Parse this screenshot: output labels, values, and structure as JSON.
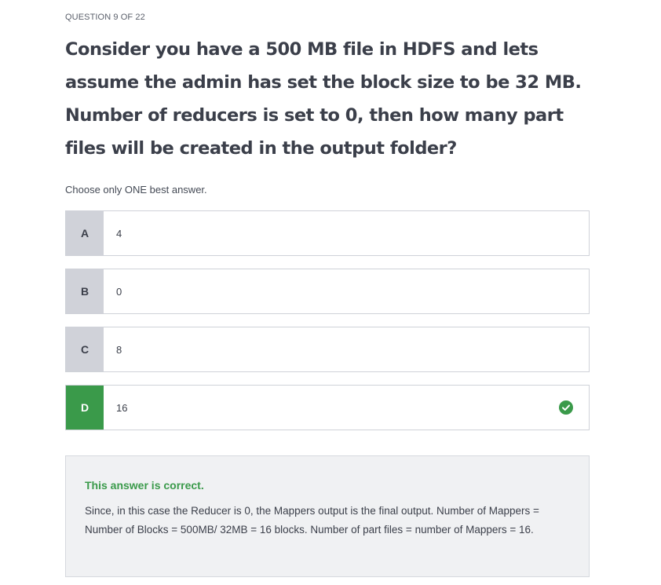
{
  "header": {
    "counter": "QUESTION 9 OF 22"
  },
  "question": {
    "text": "Consider you have a 500 MB file in HDFS and lets assume the admin has set the block size to be 32 MB. Number of reducers is set to 0, then how many part files will be created in the output folder?",
    "instruction": "Choose only ONE best answer."
  },
  "options": [
    {
      "letter": "A",
      "text": "4"
    },
    {
      "letter": "B",
      "text": "0"
    },
    {
      "letter": "C",
      "text": "8"
    },
    {
      "letter": "D",
      "text": "16"
    }
  ],
  "selected": "D",
  "feedback": {
    "verdict": "This answer is correct.",
    "explanation": "Since, in this case the Reducer is 0, the Mappers output is the final output. Number of Mappers = Number of Blocks = 500MB/ 32MB = 16 blocks. Number of part files = number of Mappers = 16."
  },
  "icons": {
    "correct": "check-circle-icon"
  },
  "colors": {
    "correct_green": "#3a9a4a",
    "letter_bg": "#d0d2d9",
    "feedback_bg": "#f0f1f3"
  }
}
